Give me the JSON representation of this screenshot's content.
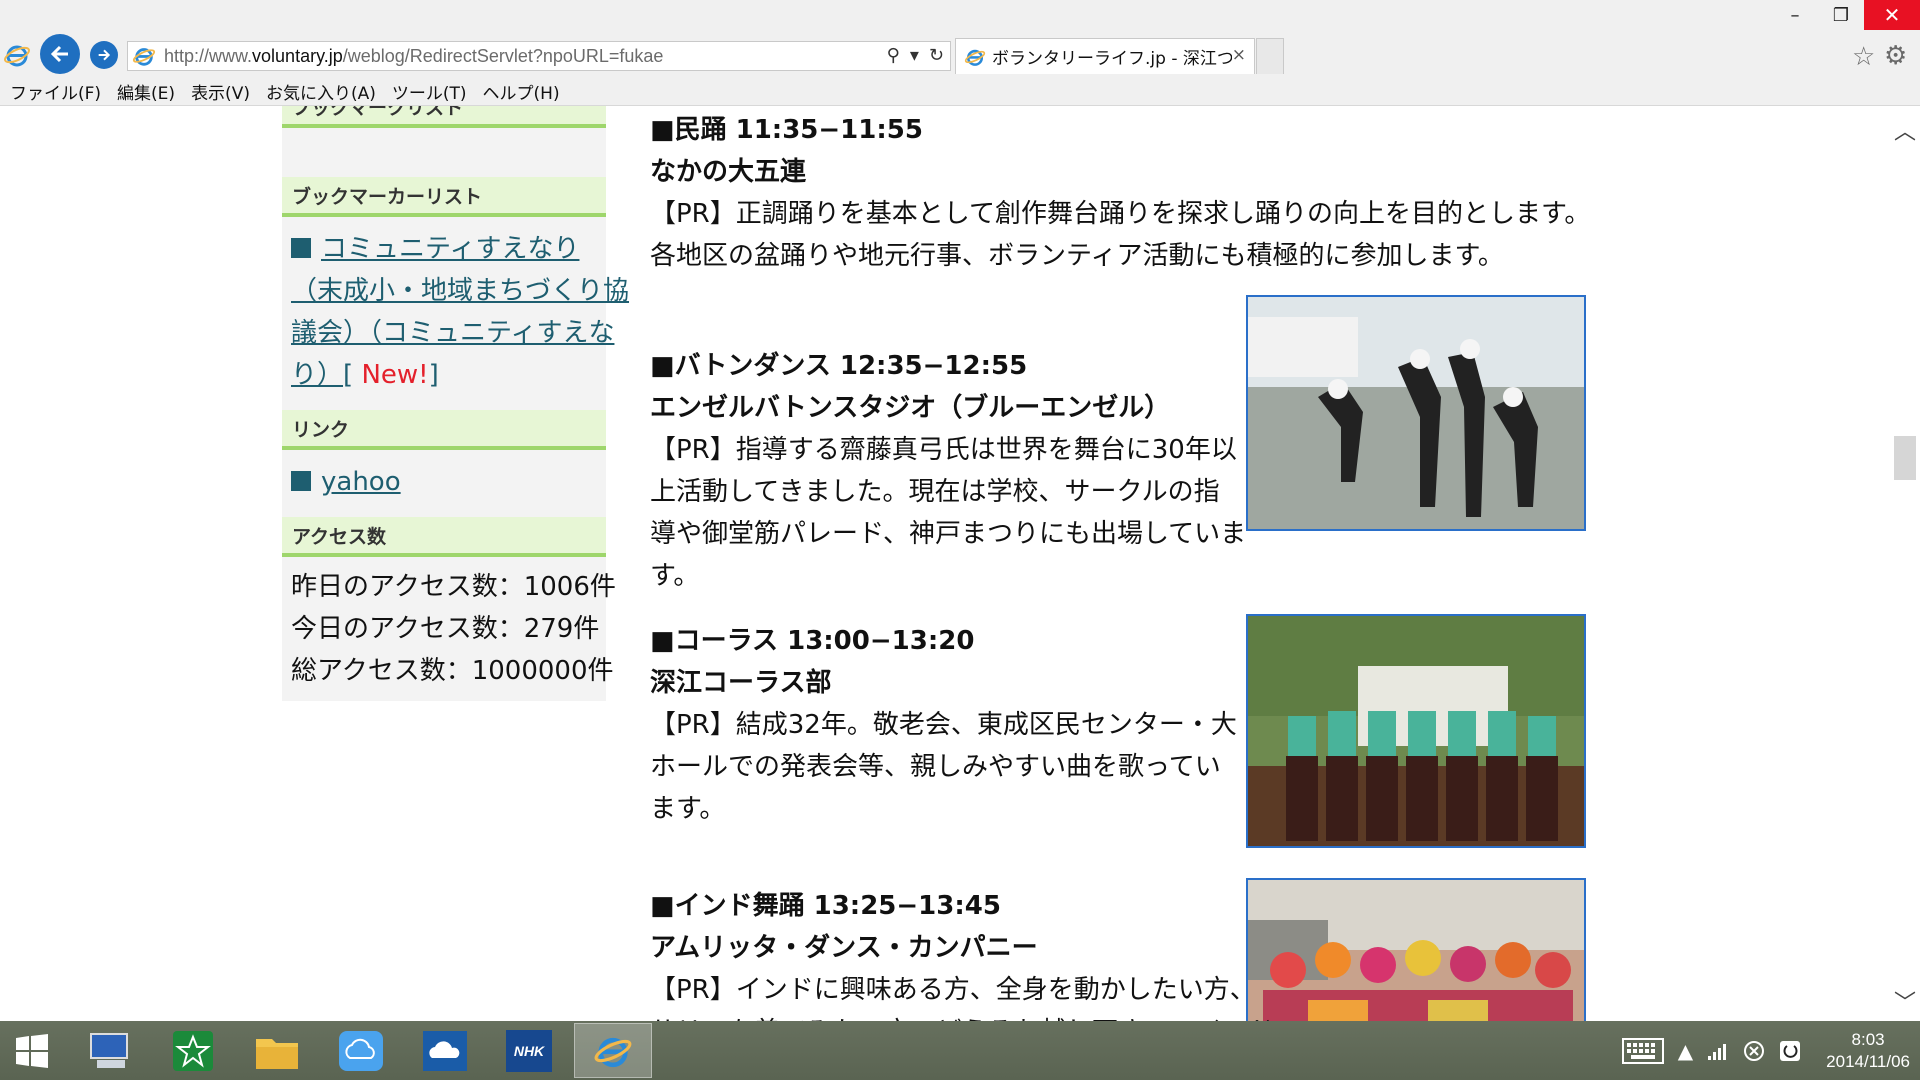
{
  "browser": {
    "url_prefix": "http://www.",
    "url_domain": "voluntary.jp",
    "url_path": "/weblog/RedirectServlet?npoURL=fukae",
    "tab_title": "ボランタリーライフ.jp - 深江つな...",
    "tab_close": "×",
    "menu": [
      "ファイル(F)",
      "編集(E)",
      "表示(V)",
      "お気に入り(A)",
      "ツール(T)",
      "ヘルプ(H)"
    ],
    "window_controls": [
      "–",
      "❐",
      "✕"
    ]
  },
  "sidebar": {
    "top_head": "ブックマークリスト",
    "bookmarker_head": "ブックマーカーリスト",
    "community_link_lines": [
      "コミュニティすえなり",
      "（末成小・地域まちづくり協",
      "議会）（コミュニティすえな",
      "り）"
    ],
    "new_open": "[ ",
    "new_label": "New!",
    "new_close": "]",
    "links_head": "リンク",
    "yahoo_link": "yahoo",
    "access_head": "アクセス数",
    "access": [
      "昨日のアクセス数：1006件",
      "今日のアクセス数：279件",
      "総アクセス数：1000000件"
    ]
  },
  "main": {
    "min_heading": "■民踊 11:35−11:55",
    "min_group": "なかの大五連",
    "min_desc": [
      "【PR】正調踊りを基本として創作舞台踊りを探求し踊りの向上を目的とします。",
      "各地区の盆踊りや地元行事、ボランティア活動にも積極的に参加します。"
    ],
    "baton_heading": "■バトンダンス 12:35−12:55",
    "baton_group": "エンゼルバトンスタジオ（ブルーエンゼル）",
    "baton_desc": [
      "【PR】指導する齋藤真弓氏は世界を舞台に30年以",
      "上活動してきました。現在は学校、サークルの指",
      "導や御堂筋パレード、神戸まつりにも出場していま",
      "す。"
    ],
    "chorus_heading": "■コーラス 13:00−13:20",
    "chorus_group": "深江コーラス部",
    "chorus_desc": [
      "【PR】結成32年。敬老会、東成区民センター・大",
      "ホールでの発表会等、親しみやすい曲を歌ってい",
      "ます。"
    ],
    "india_heading": "■インド舞踊 13:25−13:45",
    "india_group": "アムリッタ・ダンス・カンパニー",
    "india_desc": [
      "【PR】インドに興味ある方、全身を動かしたい方、",
      "サリーを着てみたい方、どうぞお越し下さい。インド"
    ]
  },
  "taskbar": {
    "nhk_label": "NHK",
    "time": "8:03",
    "date": "2014/11/06"
  },
  "colors": {
    "accent": "#1f6fc0",
    "sidebar_head_bg": "#e7f6d5",
    "sidebar_head_border": "#9ed66b",
    "link": "#1e5e70",
    "new": "#e4202b",
    "photo_border": "#2a6fc9"
  }
}
